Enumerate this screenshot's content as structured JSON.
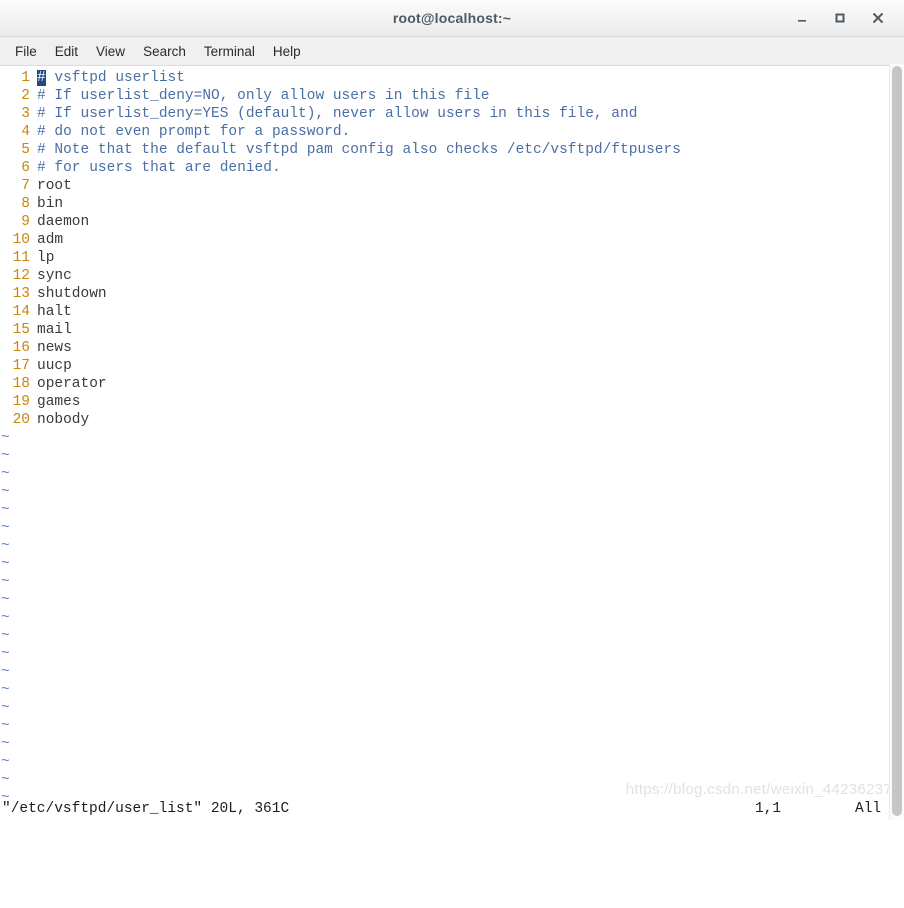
{
  "window": {
    "title": "root@localhost:~",
    "controls": [
      {
        "name": "minimize",
        "label": "–"
      },
      {
        "name": "maximize",
        "label": "□"
      },
      {
        "name": "close",
        "label": "×"
      }
    ]
  },
  "menubar": {
    "items": [
      {
        "label": "File"
      },
      {
        "label": "Edit"
      },
      {
        "label": "View"
      },
      {
        "label": "Search"
      },
      {
        "label": "Terminal"
      },
      {
        "label": "Help"
      }
    ]
  },
  "editor": {
    "cursor_char": "#",
    "lines": [
      {
        "no": "1",
        "text": " vsftpd userlist",
        "type": "comment",
        "cursor": true
      },
      {
        "no": "2",
        "text": "# If userlist_deny=NO, only allow users in this file",
        "type": "comment"
      },
      {
        "no": "3",
        "text": "# If userlist_deny=YES (default), never allow users in this file, and",
        "type": "comment"
      },
      {
        "no": "4",
        "text": "# do not even prompt for a password.",
        "type": "comment"
      },
      {
        "no": "5",
        "text": "# Note that the default vsftpd pam config also checks /etc/vsftpd/ftpusers",
        "type": "comment"
      },
      {
        "no": "6",
        "text": "# for users that are denied.",
        "type": "comment"
      },
      {
        "no": "7",
        "text": "root",
        "type": "text"
      },
      {
        "no": "8",
        "text": "bin",
        "type": "text"
      },
      {
        "no": "9",
        "text": "daemon",
        "type": "text"
      },
      {
        "no": "10",
        "text": "adm",
        "type": "text"
      },
      {
        "no": "11",
        "text": "lp",
        "type": "text"
      },
      {
        "no": "12",
        "text": "sync",
        "type": "text"
      },
      {
        "no": "13",
        "text": "shutdown",
        "type": "text"
      },
      {
        "no": "14",
        "text": "halt",
        "type": "text"
      },
      {
        "no": "15",
        "text": "mail",
        "type": "text"
      },
      {
        "no": "16",
        "text": "news",
        "type": "text"
      },
      {
        "no": "17",
        "text": "uucp",
        "type": "text"
      },
      {
        "no": "18",
        "text": "operator",
        "type": "text"
      },
      {
        "no": "19",
        "text": "games",
        "type": "text"
      },
      {
        "no": "20",
        "text": "nobody",
        "type": "text"
      }
    ],
    "empty_marker": "~",
    "empty_line_count": 21
  },
  "statusbar": {
    "file_info": "\"/etc/vsftpd/user_list\" 20L, 361C",
    "position": "1,1",
    "scroll": "All"
  },
  "watermark": "https://blog.csdn.net/weixin_44236237",
  "colors": {
    "comment": "#4a6fa5",
    "lineno": "#c8860d",
    "text": "#3a3a3a",
    "cursor_bg": "#234a86",
    "tilde": "#5b83c4",
    "titlebar_text": "#4b5a63"
  }
}
